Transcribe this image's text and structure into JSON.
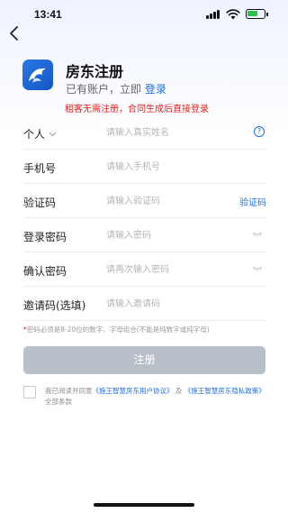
{
  "status_bar": {
    "time": "13:41"
  },
  "header": {
    "title": "房东注册",
    "subtitle_prefix": "已有账户，立即",
    "login_link": "登录"
  },
  "notice": "租客无需注册，合同生成后直接登录",
  "form": {
    "type_row": {
      "label": "个人",
      "placeholder": "请输入真实姓名"
    },
    "phone_row": {
      "label": "手机号",
      "placeholder": "请输入手机号"
    },
    "code_row": {
      "label": "验证码",
      "placeholder": "请输入验证码",
      "action": "验证码"
    },
    "password_row": {
      "label": "登录密码",
      "placeholder": "请输入密码"
    },
    "confirm_row": {
      "label": "确认密码",
      "placeholder": "请再次输入密码"
    },
    "invite_row": {
      "label": "邀请码(选填)",
      "placeholder": "请输入邀请码"
    }
  },
  "hint": {
    "star": "*",
    "text": "密码必须是8-20位的数字、字母组合(不能是纯数字或纯字母)"
  },
  "register_button": "注册",
  "agreement": {
    "prefix": "我已阅读并同意",
    "user_agreement": "《施王智慧房东用户协议》",
    "and": "及",
    "privacy_policy": "《施王智慧房东隐私政策》",
    "suffix": "全部条款"
  },
  "colors": {
    "accent": "#1f6fe0",
    "warning": "#e2211c",
    "button_disabled": "#b9bfc9",
    "battery": "#2fc34a"
  }
}
